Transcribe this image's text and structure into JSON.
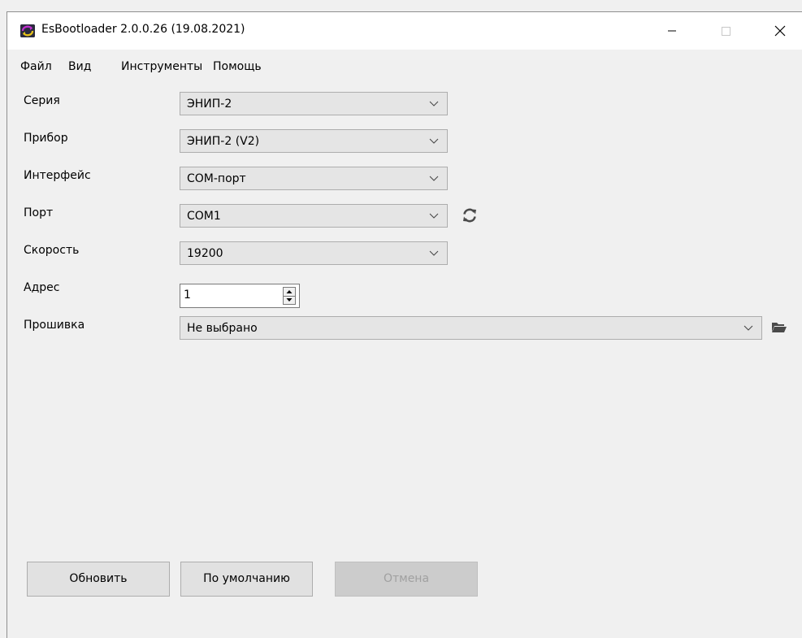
{
  "window": {
    "title": "EsBootloader 2.0.0.26 (19.08.2021)",
    "app_icon": "app-logo-icon",
    "controls": [
      "minimize-icon",
      "maximize-icon",
      "close-icon"
    ]
  },
  "menu": {
    "items": [
      "Файл",
      "Вид",
      "Инструменты",
      "Помощь"
    ]
  },
  "form": {
    "series": {
      "label": "Серия",
      "value": "ЭНИП-2"
    },
    "device": {
      "label": "Прибор",
      "value": "ЭНИП-2 (V2)"
    },
    "interface": {
      "label": "Интерфейс",
      "value": "COM-порт"
    },
    "port": {
      "label": "Порт",
      "value": "COM1",
      "refresh_icon": "refresh-icon"
    },
    "speed": {
      "label": "Скорость",
      "value": "19200"
    },
    "address": {
      "label": "Адрес",
      "value": "1"
    },
    "firmware": {
      "label": "Прошивка",
      "value": "Не выбрано",
      "browse_icon": "folder-open-icon"
    }
  },
  "buttons": {
    "update": "Обновить",
    "defaults": "По умолчанию",
    "cancel": "Отмена"
  },
  "colors": {
    "window_bg": "#f0f0f0",
    "titlebar_bg": "#ffffff",
    "combo_bg": "#e5e5e5",
    "disabled_button_bg": "#cccccc"
  }
}
